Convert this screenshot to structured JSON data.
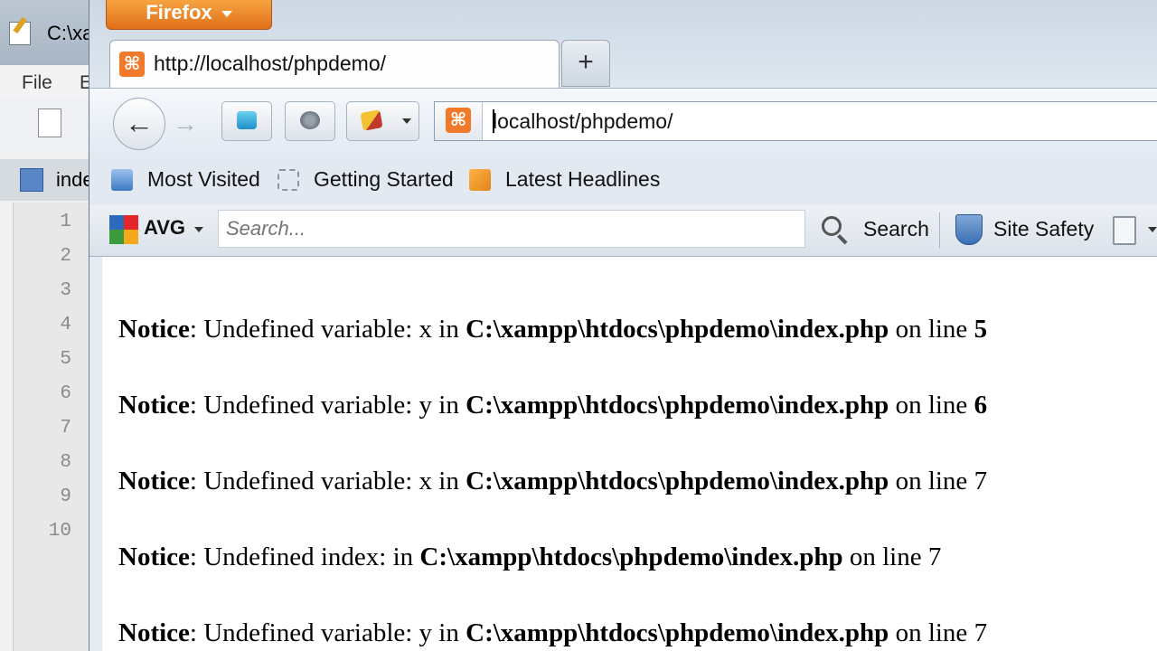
{
  "editor": {
    "title": "C:\\xa",
    "menu": [
      "File",
      "E"
    ],
    "tab_label": "inde",
    "line_numbers": [
      "1",
      "2",
      "3",
      "4",
      "5",
      "6",
      "7",
      "8",
      "9",
      "10"
    ]
  },
  "firefox": {
    "app_button": "Firefox",
    "tab_title": "http://localhost/phpdemo/",
    "new_tab": "+",
    "url": "localhost/phpdemo/",
    "bookmarks": [
      "Most Visited",
      "Getting Started",
      "Latest Headlines"
    ],
    "avg": {
      "logo_text": "AVG",
      "search_placeholder": "Search...",
      "search_button": "Search",
      "site_safety": "Site Safety"
    }
  },
  "page": {
    "notices": [
      {
        "label": "Notice",
        "message": ": Undefined variable: x in ",
        "path": "C:\\xampp\\htdocs\\phpdemo\\index.php",
        "on_line": " on line ",
        "line": "5",
        "line_bold": true
      },
      {
        "label": "Notice",
        "message": ": Undefined variable: y in ",
        "path": "C:\\xampp\\htdocs\\phpdemo\\index.php",
        "on_line": " on line ",
        "line": "6",
        "line_bold": true
      },
      {
        "label": "Notice",
        "message": ": Undefined variable: x in ",
        "path": "C:\\xampp\\htdocs\\phpdemo\\index.php",
        "on_line": " on line ",
        "line": "7",
        "line_bold": false
      },
      {
        "label": "Notice",
        "message": ": Undefined index: in ",
        "path": "C:\\xampp\\htdocs\\phpdemo\\index.php",
        "on_line": " on line ",
        "line": "7",
        "line_bold": false
      },
      {
        "label": "Notice",
        "message": ": Undefined variable: y in ",
        "path": "C:\\xampp\\htdocs\\phpdemo\\index.php",
        "on_line": " on line ",
        "line": "7",
        "line_bold": false
      }
    ]
  },
  "colors": {
    "firefox_button": "#e0701a",
    "favicon": "#f07a2a"
  }
}
